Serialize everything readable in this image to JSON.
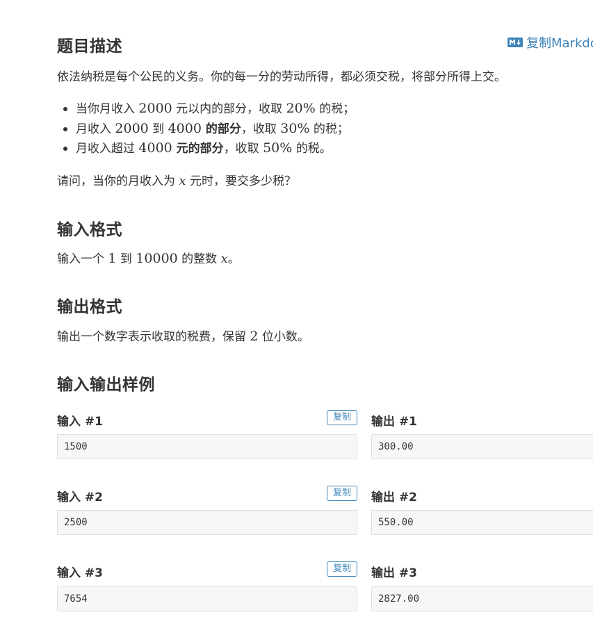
{
  "description": {
    "title": "题目描述",
    "copy_markdown": "复制Markdown",
    "intro": "依法纳税是每个公民的义务。你的每一分的劳动所得，都必须交税，将部分所得上交。",
    "rules": [
      {
        "a": "当你月收入 ",
        "n1": "2000",
        "b": " 元以内的部分，收取 ",
        "n2": "20%",
        "c": " 的税；"
      },
      {
        "a": "月收入 ",
        "n1": "2000",
        "b": " 到 ",
        "n2": "4000",
        "bold": " 的部分",
        "c": "，收取 ",
        "n3": "30%",
        "d": " 的税；"
      },
      {
        "a": "月收入超过 ",
        "n1": "4000",
        "bold": " 元的部分",
        "b": "，收取 ",
        "n2": "50%",
        "c": " 的税。"
      }
    ],
    "question_a": "请问，当你的月收入为 ",
    "question_var": "x",
    "question_b": " 元时，要交多少税？"
  },
  "input_format": {
    "title": "输入格式",
    "a": "输入一个 ",
    "n1": "1",
    "b": " 到 ",
    "n2": "10000",
    "c": " 的整数 ",
    "var": "x",
    "d": "。"
  },
  "output_format": {
    "title": "输出格式",
    "a": "输出一个数字表示收取的税费，保留 ",
    "n": "2",
    "b": " 位小数。"
  },
  "samples": {
    "title": "输入输出样例",
    "copy_label": "复制",
    "items": [
      {
        "in_label": "输入 #1",
        "out_label": "输出 #1",
        "input": "1500",
        "output": "300.00"
      },
      {
        "in_label": "输入 #2",
        "out_label": "输出 #2",
        "input": "2500",
        "output": "550.00"
      },
      {
        "in_label": "输入 #3",
        "out_label": "输出 #3",
        "input": "7654",
        "output": "2827.00"
      }
    ]
  },
  "colors": {
    "accent": "#3d84b9",
    "text": "#333333",
    "code_bg": "#f7f7f7",
    "border": "#dddddd"
  },
  "icons": {
    "markdown": "markdown-icon"
  }
}
